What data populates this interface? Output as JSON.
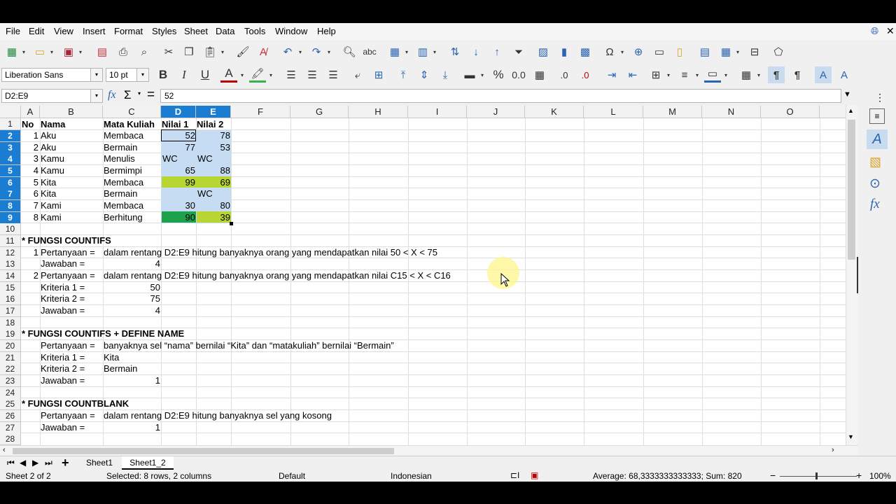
{
  "menubar": {
    "items": [
      "File",
      "Edit",
      "View",
      "Insert",
      "Format",
      "Styles",
      "Sheet",
      "Data",
      "Tools",
      "Window",
      "Help"
    ]
  },
  "formatting": {
    "font_name": "Liberation Sans",
    "font_size": "10 pt"
  },
  "formula_bar": {
    "name_box": "D2:E9",
    "content": "52"
  },
  "columns": [
    "A",
    "B",
    "C",
    "D",
    "E",
    "F",
    "G",
    "H",
    "I",
    "J",
    "K",
    "L",
    "M",
    "N",
    "O"
  ],
  "rows": [
    "1",
    "2",
    "3",
    "4",
    "5",
    "6",
    "7",
    "8",
    "9",
    "10",
    "11",
    "12",
    "13",
    "14",
    "15",
    "16",
    "17",
    "18",
    "19",
    "20",
    "21",
    "22",
    "23",
    "24",
    "25",
    "26",
    "27",
    "28"
  ],
  "cells": {
    "r1": {
      "A": "No",
      "B": "Nama",
      "C": "Mata Kuliah",
      "D": "Nilai 1",
      "E": "Nilai 2"
    },
    "r2": {
      "A": "1",
      "B": "Aku",
      "C": "Membaca",
      "D": "52",
      "E": "78"
    },
    "r3": {
      "A": "2",
      "B": "Aku",
      "C": "Bermain",
      "D": "77",
      "E": "53"
    },
    "r4": {
      "A": "3",
      "B": "Kamu",
      "C": "Menulis",
      "D": "WC",
      "E": "WC"
    },
    "r5": {
      "A": "4",
      "B": "Kamu",
      "C": "Bermimpi",
      "D": "65",
      "E": "88"
    },
    "r6": {
      "A": "5",
      "B": "Kita",
      "C": "Membaca",
      "D": "99",
      "E": "69"
    },
    "r7": {
      "A": "6",
      "B": "Kita",
      "C": "Bermain",
      "D": "",
      "E": "WC"
    },
    "r8": {
      "A": "7",
      "B": "Kami",
      "C": "Membaca",
      "D": "30",
      "E": "80"
    },
    "r9": {
      "A": "8",
      "B": "Kami",
      "C": "Berhitung",
      "D": "90",
      "E": "39"
    },
    "r11": {
      "A": "* FUNGSI COUNTIFS"
    },
    "r12": {
      "A": "1",
      "B": "Pertanyaan =",
      "C": "dalam rentang D2:E9 hitung banyaknya orang yang mendapatkan nilai 50 < X < 75"
    },
    "r13": {
      "B": "Jawaban =",
      "C": "4"
    },
    "r14": {
      "A": "2",
      "B": "Pertanyaan =",
      "C": "dalam rentang D2:E9 hitung banyaknya orang yang mendapatkan nilai C15 < X < C16"
    },
    "r15": {
      "B": "Kriteria 1 =",
      "C": "50"
    },
    "r16": {
      "B": "Kriteria 2 =",
      "C": "75"
    },
    "r17": {
      "B": "Jawaban =",
      "C": "4"
    },
    "r19": {
      "A": "* FUNGSI COUNTIFS + DEFINE NAME"
    },
    "r20": {
      "B": "Pertanyaan =",
      "C": "banyaknya sel “nama” bernilai “Kita” dan “matakuliah” bernilai “Bermain”"
    },
    "r21": {
      "B": "Kriteria 1 =",
      "C": "Kita"
    },
    "r22": {
      "B": "Kriteria 2 =",
      "C": "Bermain"
    },
    "r23": {
      "B": "Jawaban =",
      "C": "1"
    },
    "r25": {
      "A": "* FUNGSI COUNTBLANK"
    },
    "r26": {
      "B": "Pertanyaan =",
      "C": "dalam rentang D2:E9 hitung banyaknya sel yang kosong"
    },
    "r27": {
      "B": "Jawaban =",
      "C": "1"
    }
  },
  "sheet_tabs": {
    "add_symbol": "+",
    "tabs": [
      "Sheet1",
      "Sheet1_2"
    ],
    "active": "Sheet1_2"
  },
  "status": {
    "sheet": "Sheet 2 of 2",
    "selection": "Selected: 8 rows, 2 columns",
    "page_style": "Default",
    "language": "Indonesian",
    "summary": "Average: 68,3333333333333; Sum: 820",
    "zoom": "100%"
  },
  "colors": {
    "selection_header": "#1a7dd1",
    "selection_fill": "#c6dcf2",
    "highlight_green": "#b9d532",
    "dark_green": "#1ea14c"
  }
}
